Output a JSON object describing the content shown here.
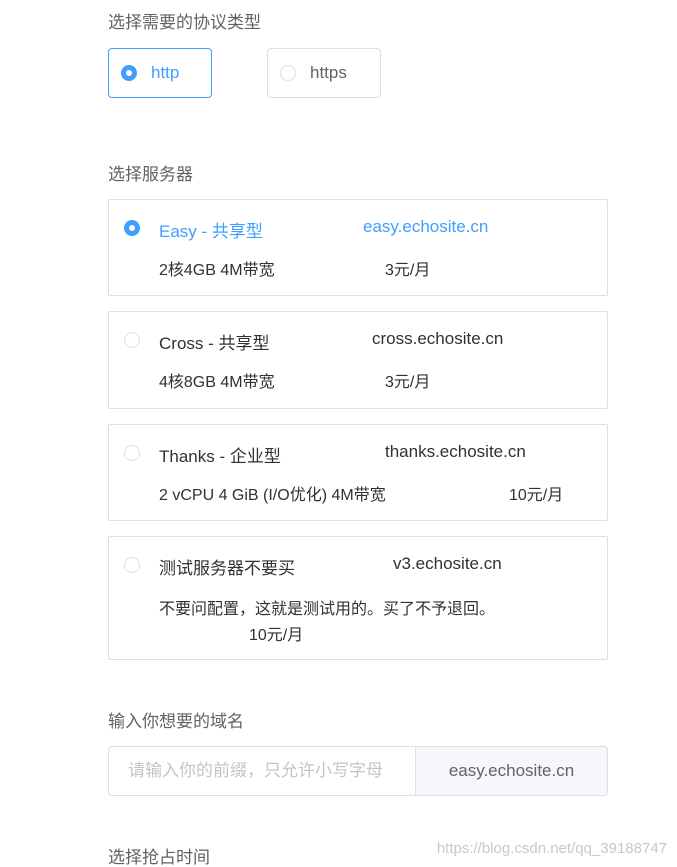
{
  "protocol": {
    "label": "选择需要的协议类型",
    "options": [
      {
        "label": "http",
        "selected": true
      },
      {
        "label": "https",
        "selected": false
      }
    ]
  },
  "server": {
    "label": "选择服务器",
    "options": [
      {
        "name": "Easy - 共享型",
        "host": "easy.echosite.cn",
        "spec": "2核4GB 4M带宽",
        "price": "3元/月",
        "selected": true
      },
      {
        "name": "Cross - 共享型",
        "host": "cross.echosite.cn",
        "spec": "4核8GB 4M带宽",
        "price": "3元/月",
        "selected": false
      },
      {
        "name": "Thanks - 企业型",
        "host": "thanks.echosite.cn",
        "spec": "2 vCPU 4 GiB (I/O优化) 4M带宽",
        "price": "10元/月",
        "selected": false
      },
      {
        "name": "测试服务器不要买",
        "host": "v3.echosite.cn",
        "spec": "不要问配置，这就是测试用的。买了不予退回。",
        "price": "10元/月",
        "selected": false
      }
    ]
  },
  "domain": {
    "label": "输入你想要的域名",
    "placeholder": "请输入你的前缀，只允许小写字母",
    "value": "",
    "suffix": "easy.echosite.cn"
  },
  "time": {
    "label": "选择抢占时间"
  },
  "watermark": "https://blog.csdn.net/qq_39188747",
  "colors": {
    "accent": "#409eff",
    "border": "#dcdfe6",
    "text": "#303133",
    "placeholder": "#c0c4cc"
  }
}
